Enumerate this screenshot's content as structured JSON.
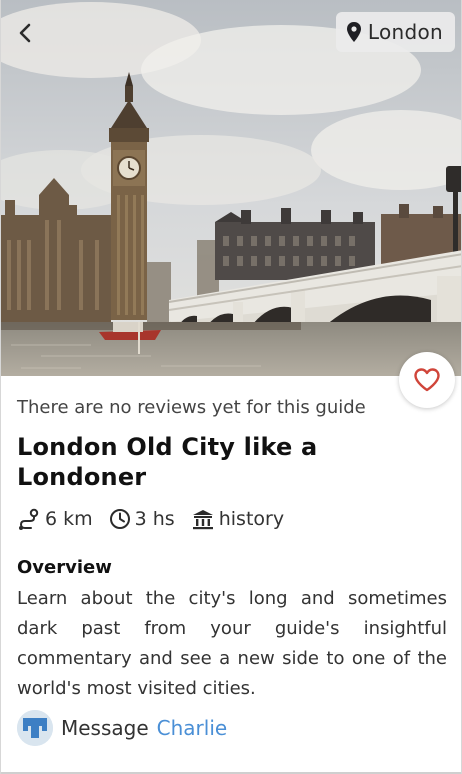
{
  "nav": {
    "back_icon": "chevron-left-icon",
    "location_icon": "map-pin-icon",
    "location_label": "London"
  },
  "hero": {
    "image_alt": "",
    "favorite_icon": "heart-outline-icon",
    "favorite_color": "#d0453a"
  },
  "guide": {
    "reviews_note": "There are no reviews yet for this guide",
    "title": "London Old City like a Londoner",
    "distance_icon": "route-icon",
    "distance": "6 km",
    "duration_icon": "clock-icon",
    "duration": "3 hs",
    "category_icon": "museum-icon",
    "category": "history",
    "overview_heading": "Overview",
    "overview_text": "Learn about the city's long and sometimes dark past from your guide's insightful commentary and see a new side to one of the world's most visited cities."
  },
  "contact": {
    "avatar_icon": "host-avatar",
    "message_label": "Message",
    "host_name": "Charlie",
    "host_color": "#4a8fd6"
  }
}
